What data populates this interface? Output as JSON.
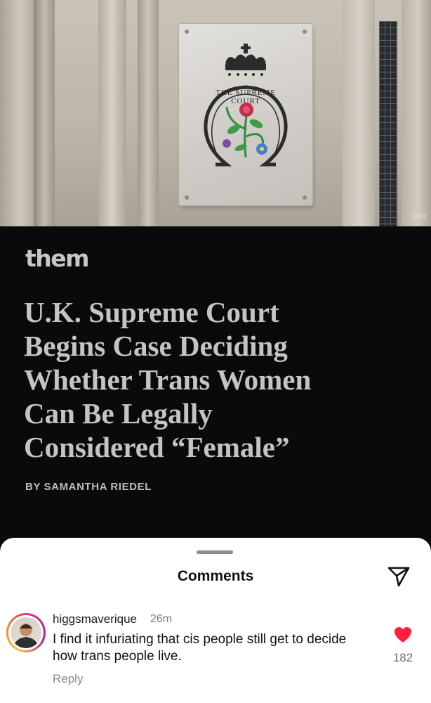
{
  "article": {
    "brand": "them",
    "headline": "U.K. Supreme Court Begins Case Deciding Whether Trans Women Can Be Legally Considered “Female”",
    "byline": "BY SAMANTHA RIEDEL",
    "photo_credit": "Getty",
    "plaque_text": "THE SUPREME COURT"
  },
  "comments_sheet": {
    "title": "Comments",
    "share_icon": "paper-plane-icon",
    "comments": [
      {
        "username": "higgsmaverique",
        "time": "26m",
        "text": "I find it infuriating that cis people still get to decide how trans people live.",
        "reply_label": "Reply",
        "likes": "182",
        "liked": true,
        "like_color": "#ff1f3d"
      }
    ]
  }
}
